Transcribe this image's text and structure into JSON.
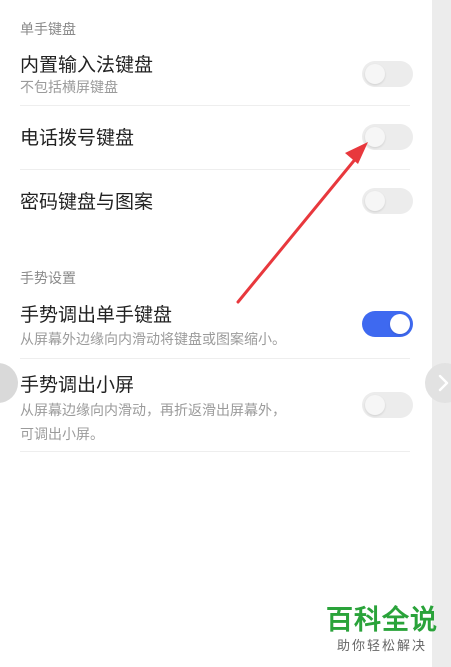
{
  "sections": {
    "one_handed_header": "单手键盘",
    "gesture_header": "手势设置"
  },
  "rows": {
    "builtin_ime": {
      "title": "内置输入法键盘",
      "subtitle": "不包括横屏键盘",
      "toggle_on": false
    },
    "dialer": {
      "title": "电话拨号键盘",
      "toggle_on": false
    },
    "password": {
      "title": "密码键盘与图案",
      "toggle_on": false
    },
    "gesture_one_handed": {
      "title": "手势调出单手键盘",
      "subtitle": "从屏幕外边缘向内滑动将键盘或图案缩小。",
      "toggle_on": true
    },
    "gesture_small_screen": {
      "title": "手势调出小屏",
      "subtitle_line1": "从屏幕边缘向内滑动，再折返滑出屏幕外，",
      "subtitle_line2": "可调出小屏。",
      "toggle_on": false
    }
  },
  "watermark": {
    "main": "百科全说",
    "sub": "助你轻松解决"
  },
  "colors": {
    "accent_blue": "#3e69f0",
    "annotation_red": "#e8383d",
    "watermark_green": "#2aa33a"
  },
  "icons": {
    "nav_right": "chevron-right-icon",
    "nav_left": "chevron-left-icon"
  }
}
